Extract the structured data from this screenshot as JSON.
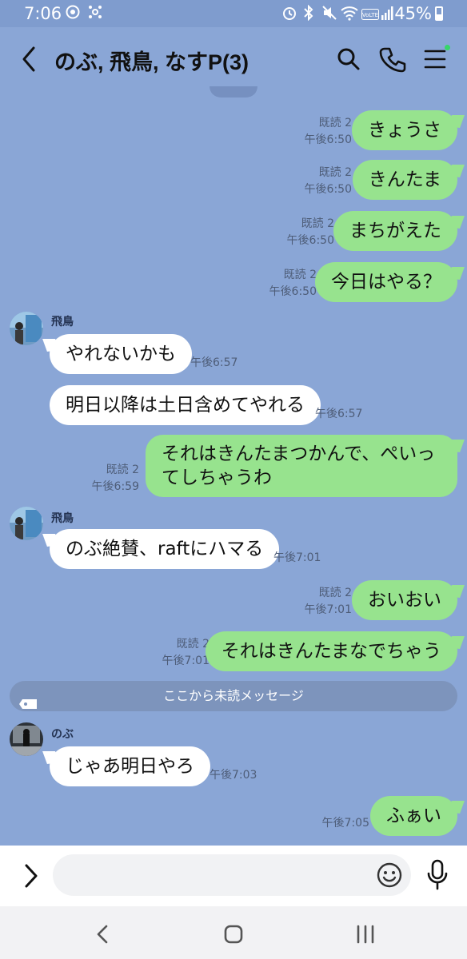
{
  "status_bar": {
    "time": "7:06",
    "battery": "45%",
    "icons": [
      "record-icon",
      "network-icon",
      "alarm-icon",
      "bluetooth-icon",
      "mute-icon",
      "wifi-icon",
      "volte-icon",
      "signal-icon",
      "battery-icon"
    ]
  },
  "header": {
    "title": "のぶ, 飛鳥, なすP(3)",
    "back_icon": "chevron-left-icon",
    "icons": [
      "search-icon",
      "phone-icon",
      "menu-icon"
    ],
    "online_color": "#37d66a"
  },
  "colors": {
    "background": "#8aa6d6",
    "out_bubble": "#97e38e",
    "in_bubble": "#ffffff"
  },
  "messages": [
    {
      "dir": "out",
      "text": "きょうさ",
      "read": "既読 2",
      "time": "午後6:50"
    },
    {
      "dir": "out",
      "text": "きんたま",
      "read": "既読 2",
      "time": "午後6:50"
    },
    {
      "dir": "out",
      "text": "まちがえた",
      "read": "既読 2",
      "time": "午後6:50"
    },
    {
      "dir": "out",
      "text": "今日はやる？",
      "read": "既読 2",
      "time": "午後6:50"
    },
    {
      "dir": "in",
      "sender": "飛鳥",
      "text": "やれないかも",
      "time": "午後6:57"
    },
    {
      "dir": "in",
      "text": "明日以降は土日含めてやれる",
      "time": "午後6:57"
    },
    {
      "dir": "out",
      "text": "それはきんたまつかんで、ぺいってしちゃうわ",
      "read": "既読 2",
      "time": "午後6:59"
    },
    {
      "dir": "in",
      "sender": "飛鳥",
      "text": "のぶ絶賛、raftにハマる",
      "time": "午後7:01"
    },
    {
      "dir": "out",
      "text": "おいおい",
      "read": "既読 2",
      "time": "午後7:01"
    },
    {
      "dir": "out",
      "text": "それはきんたまなでちゃう",
      "read": "既読 2",
      "time": "午後7:01"
    },
    {
      "dir": "in",
      "sender": "のぶ",
      "text": "じゃあ明日やろ",
      "time": "午後7:03"
    },
    {
      "dir": "out",
      "text": "ふぁい",
      "time": "午後7:05"
    }
  ],
  "unread_divider": "ここから未読メッセージ",
  "input_bar": {
    "placeholder": "",
    "icons": [
      "expand-icon",
      "emoji-icon",
      "mic-icon"
    ]
  },
  "nav_bar": {
    "icons": [
      "back-nav-icon",
      "home-nav-icon",
      "recents-nav-icon"
    ]
  }
}
